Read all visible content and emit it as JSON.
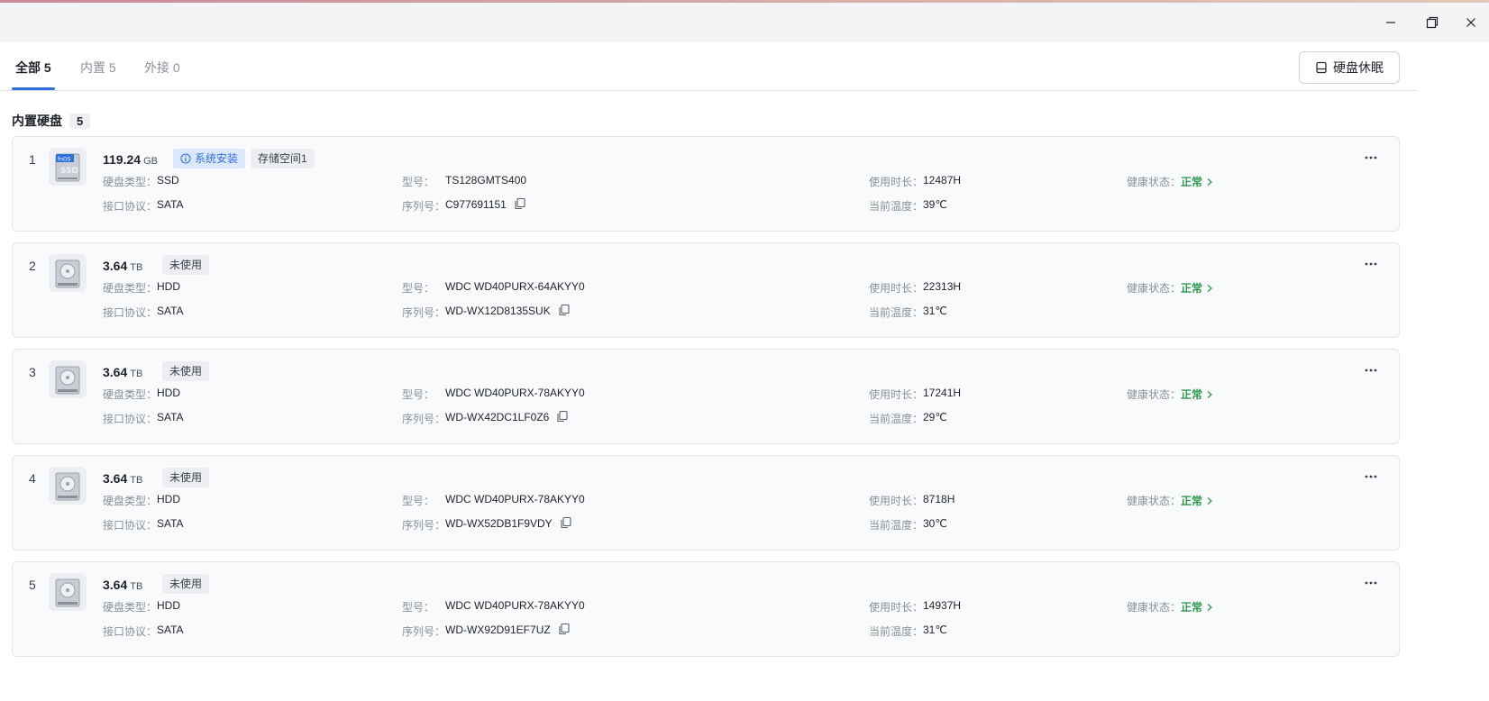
{
  "tabs": [
    {
      "label": "全部 5"
    },
    {
      "label": "内置 5"
    },
    {
      "label": "外接 0"
    }
  ],
  "sleep_button": "硬盘休眠",
  "section": {
    "title": "内置硬盘",
    "count": "5"
  },
  "labels": {
    "type": "硬盘类型：",
    "model": "型号：",
    "usage": "使用时长：",
    "health": "健康状态：",
    "interface": "接口协议：",
    "serial": "序列号：",
    "temp": "当前温度："
  },
  "icon_badge": "fnOS",
  "icon_ssd": "SSD",
  "disks": [
    {
      "index": "1",
      "capacity": "119.24",
      "unit": "GB",
      "tags": [
        "系统安装",
        "存储空间1"
      ],
      "type": "SSD",
      "model": "TS128GMTS400",
      "usage": "12487H",
      "health": "正常",
      "interface": "SATA",
      "serial": "C977691151",
      "temp": "39℃"
    },
    {
      "index": "2",
      "capacity": "3.64",
      "unit": "TB",
      "tags": [
        "未使用"
      ],
      "type": "HDD",
      "model": "WDC WD40PURX-64AKYY0",
      "usage": "22313H",
      "health": "正常",
      "interface": "SATA",
      "serial": "WD-WX12D8135SUK",
      "temp": "31℃"
    },
    {
      "index": "3",
      "capacity": "3.64",
      "unit": "TB",
      "tags": [
        "未使用"
      ],
      "type": "HDD",
      "model": "WDC WD40PURX-78AKYY0",
      "usage": "17241H",
      "health": "正常",
      "interface": "SATA",
      "serial": "WD-WX42DC1LF0Z6",
      "temp": "29℃"
    },
    {
      "index": "4",
      "capacity": "3.64",
      "unit": "TB",
      "tags": [
        "未使用"
      ],
      "type": "HDD",
      "model": "WDC WD40PURX-78AKYY0",
      "usage": "8718H",
      "health": "正常",
      "interface": "SATA",
      "serial": "WD-WX52DB1F9VDY",
      "temp": "30℃"
    },
    {
      "index": "5",
      "capacity": "3.64",
      "unit": "TB",
      "tags": [
        "未使用"
      ],
      "type": "HDD",
      "model": "WDC WD40PURX-78AKYY0",
      "usage": "14937H",
      "health": "正常",
      "interface": "SATA",
      "serial": "WD-WX92D91EF7UZ",
      "temp": "31℃"
    }
  ],
  "colors": {
    "accent": "#2f6fde",
    "healthy": "#2e9a4f"
  }
}
